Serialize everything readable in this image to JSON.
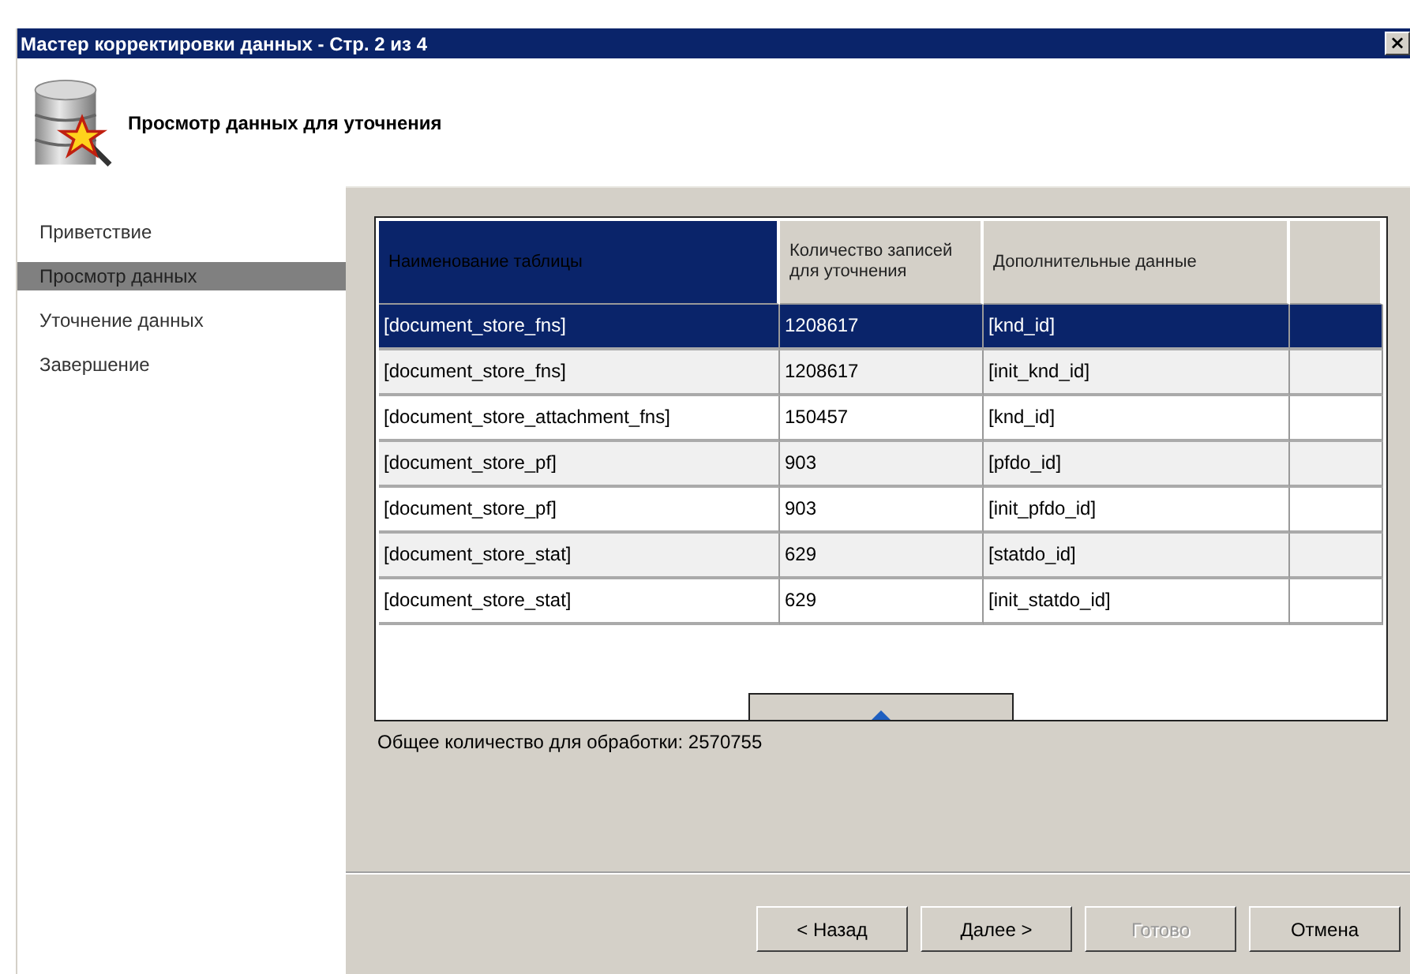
{
  "window": {
    "title": "Мастер корректировки данных - Стр. 2 из 4",
    "close": "×"
  },
  "header": {
    "title": "Просмотр данных для уточнения"
  },
  "sidebar": {
    "items": [
      {
        "label": "Приветствие",
        "selected": false
      },
      {
        "label": "Просмотр данных",
        "selected": true
      },
      {
        "label": "Уточнение данных",
        "selected": false
      },
      {
        "label": "Завершение",
        "selected": false
      }
    ]
  },
  "table": {
    "columns": [
      {
        "label": "Наименование таблицы",
        "selected": true
      },
      {
        "label": "Количество записей для уточнения",
        "selected": false
      },
      {
        "label": "Дополнительные данные",
        "selected": false
      }
    ],
    "rows": [
      {
        "cells": [
          "[document_store_fns]",
          "1208617",
          "[knd_id]"
        ],
        "selected": true
      },
      {
        "cells": [
          "[document_store_fns]",
          "1208617",
          "[init_knd_id]"
        ],
        "selected": false
      },
      {
        "cells": [
          "[document_store_attachment_fns]",
          "150457",
          "[knd_id]"
        ],
        "selected": false
      },
      {
        "cells": [
          "[document_store_pf]",
          "903",
          "[pfdo_id]"
        ],
        "selected": false
      },
      {
        "cells": [
          "[document_store_pf]",
          "903",
          "[init_pfdo_id]"
        ],
        "selected": false
      },
      {
        "cells": [
          "[document_store_stat]",
          "629",
          "[statdo_id]"
        ],
        "selected": false
      },
      {
        "cells": [
          "[document_store_stat]",
          "629",
          "[init_statdo_id]"
        ],
        "selected": false
      }
    ]
  },
  "total": "Общее количество для обработки: 2570755",
  "buttons": [
    {
      "label": "< Назад",
      "disabled": false
    },
    {
      "label": "Далее >",
      "disabled": false
    },
    {
      "label": "Готово",
      "disabled": true
    },
    {
      "label": "Отмена",
      "disabled": false
    }
  ]
}
